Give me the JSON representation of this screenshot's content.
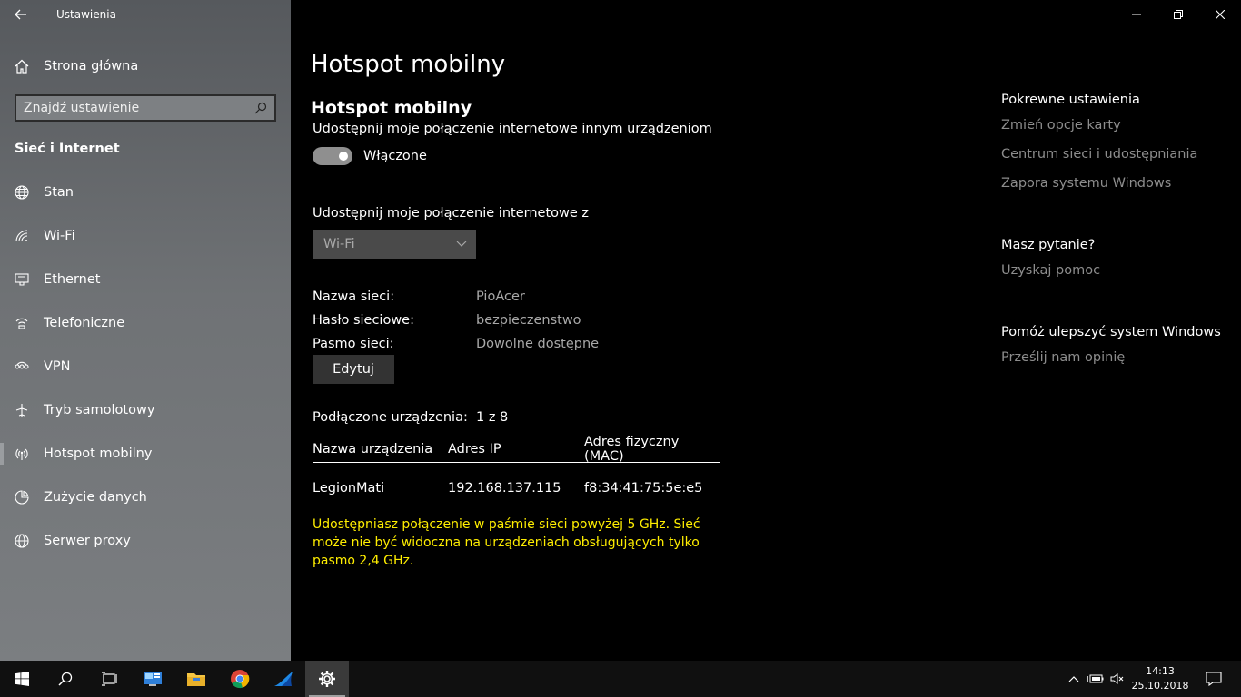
{
  "window": {
    "title": "Ustawienia"
  },
  "sidebar": {
    "home_label": "Strona główna",
    "search_placeholder": "Znajdź ustawienie",
    "section_title": "Sieć i Internet",
    "items": [
      {
        "label": "Stan",
        "icon": "globe-icon"
      },
      {
        "label": "Wi-Fi",
        "icon": "wifi-icon"
      },
      {
        "label": "Ethernet",
        "icon": "ethernet-icon"
      },
      {
        "label": "Telefoniczne",
        "icon": "dialup-icon"
      },
      {
        "label": "VPN",
        "icon": "vpn-icon"
      },
      {
        "label": "Tryb samolotowy",
        "icon": "airplane-icon"
      },
      {
        "label": "Hotspot mobilny",
        "icon": "hotspot-icon",
        "active": true
      },
      {
        "label": "Zużycie danych",
        "icon": "data-usage-icon"
      },
      {
        "label": "Serwer proxy",
        "icon": "proxy-globe-icon"
      }
    ]
  },
  "main": {
    "page_title": "Hotspot mobilny",
    "section_title": "Hotspot mobilny",
    "share_description": "Udostępnij moje połączenie internetowe innym urządzeniom",
    "toggle_state": "Włączone",
    "share_from_label": "Udostępnij moje połączenie internetowe z",
    "share_from_value": "Wi-Fi",
    "network_name_label": "Nazwa sieci:",
    "network_name_value": "PioAcer",
    "password_label": "Hasło sieciowe:",
    "password_value": "bezpieczenstwo",
    "band_label": "Pasmo sieci:",
    "band_value": "Dowolne dostępne",
    "edit_button": "Edytuj",
    "connected_label": "Podłączone urządzenia:",
    "connected_value": "1 z 8",
    "table_headers": {
      "name": "Nazwa urządzenia",
      "ip": "Adres IP",
      "mac": "Adres fizyczny (MAC)"
    },
    "devices": [
      {
        "name": "LegionMati",
        "ip": "192.168.137.115",
        "mac": "f8:34:41:75:5e:e5"
      }
    ],
    "warning": "Udostępniasz połączenie w paśmie sieci powyżej 5 GHz. Sieć może nie być widoczna na urządzeniach obsługujących tylko pasmo 2,4 GHz.",
    "warning_color": "#ffee00"
  },
  "related": {
    "heading": "Pokrewne ustawienia",
    "links": [
      "Zmień opcje karty",
      "Centrum sieci i udostępniania",
      "Zapora systemu Windows"
    ],
    "question_heading": "Masz pytanie?",
    "help_link": "Uzyskaj pomoc",
    "improve_heading": "Pomóż ulepszyć system Windows",
    "feedback_link": "Prześlij nam opinię"
  },
  "taskbar": {
    "time": "14:13",
    "date": "25.10.2018"
  }
}
